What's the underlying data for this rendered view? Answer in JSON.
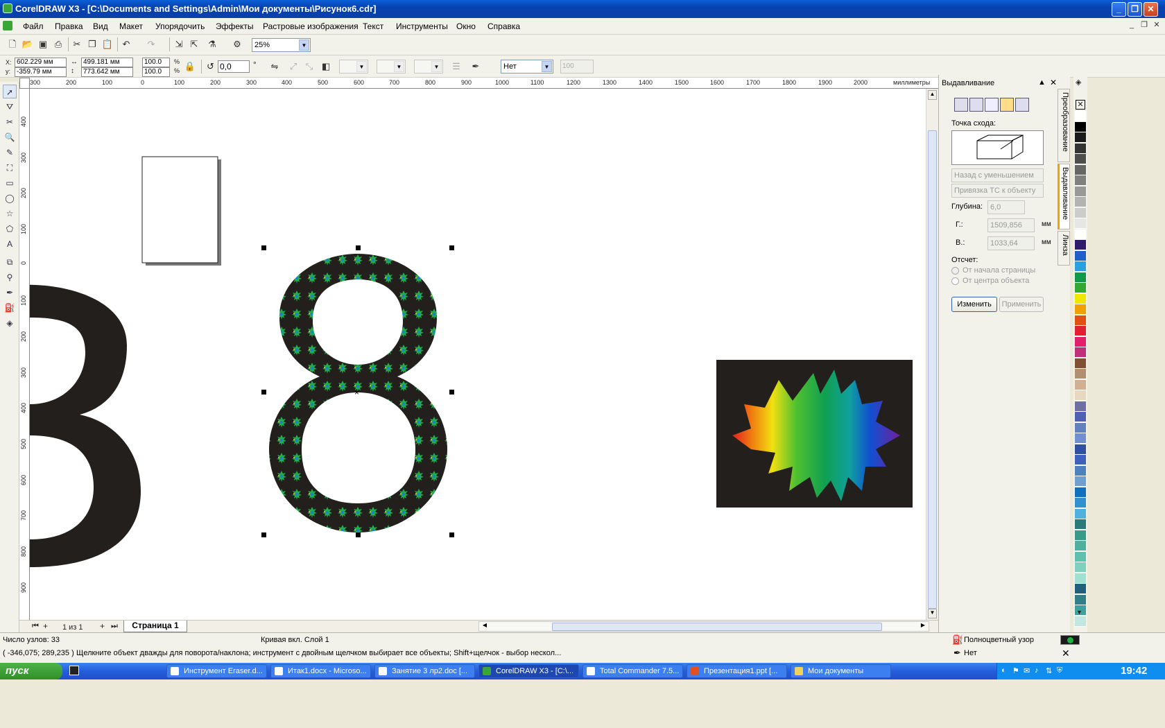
{
  "window": {
    "title": "CorelDRAW X3 - [C:\\Documents and Settings\\Admin\\Мои документы\\Рисунок6.cdr]",
    "controls": [
      "_",
      "❐",
      "✕"
    ]
  },
  "menu": [
    "Файл",
    "Правка",
    "Вид",
    "Макет",
    "Упорядочить",
    "Эффекты",
    "Растровые изображения",
    "Текст",
    "Инструменты",
    "Окно",
    "Справка"
  ],
  "standard_toolbar": {
    "zoom": "25%"
  },
  "property_bar": {
    "x": "602.229 мм",
    "y": "-359.79 мм",
    "width": "499.181 мм",
    "height": "773.642 мм",
    "scale_x": "100.0",
    "scale_y": "100.0",
    "percent": "%",
    "rotation": "0,0",
    "degree": "°",
    "outline": "Нет",
    "spin_value": "100"
  },
  "rulers": {
    "h_ticks": [
      "300",
      "200",
      "100",
      "0",
      "100",
      "200",
      "300",
      "400",
      "500",
      "600",
      "700",
      "800",
      "900",
      "1000",
      "1100",
      "1200",
      "1300",
      "1400",
      "1500",
      "1600",
      "1700",
      "1800",
      "1900",
      "2000"
    ],
    "h_unit": "миллиметры",
    "v_ticks": [
      "400",
      "300",
      "200",
      "100",
      "0",
      "100",
      "200",
      "300",
      "400",
      "500",
      "600",
      "700",
      "800",
      "900"
    ],
    "v_unit": "миллиметры"
  },
  "pages": {
    "counter": "1 из 1",
    "tab": "Страница 1"
  },
  "docker": {
    "title": "Выдавливание",
    "vanishing_label": "Точка схода:",
    "type_value": "Назад с уменьшением",
    "lock_value": "Привязка ТС к объекту",
    "depth_label": "Глубина:",
    "depth_value": "6,0",
    "h_label": "Г.:",
    "h_value": "1509,856",
    "h_unit": "мм",
    "v_label": "В.:",
    "v_value": "1033,64",
    "v_unit": "мм",
    "measure_label": "Отсчет:",
    "opt_page": "От начала страницы",
    "opt_center": "От центра объекта",
    "edit_button": "Изменить",
    "apply_button": "Применить"
  },
  "side_tabs": [
    "Преобразование",
    "Выдавливание",
    "Линза"
  ],
  "palette": [
    "#ffffff",
    "#000000",
    "#1a1a1a",
    "#333333",
    "#4d4d4d",
    "#666666",
    "#808080",
    "#999999",
    "#b3b3b3",
    "#cccccc",
    "#e6e6e6",
    "#ffffff",
    "#2e1a6e",
    "#1e5fc8",
    "#2aa0e0",
    "#0f9a4a",
    "#35a735",
    "#f0e600",
    "#f0a000",
    "#e05010",
    "#e02030",
    "#e0206a",
    "#c0307a",
    "#805030",
    "#b09070",
    "#d0b090",
    "#e8d8c0",
    "#7070a0",
    "#5060b0",
    "#6080c0",
    "#7090d0",
    "#3050a0",
    "#4060c0",
    "#5080c0",
    "#70a0d0",
    "#1070c0",
    "#3090d0",
    "#50b0e0",
    "#2a7a7a",
    "#3a9a8a",
    "#50b0a0",
    "#60c0b0",
    "#80d0c0",
    "#a0e0d0",
    "#20607a",
    "#30808a",
    "#40a0a0",
    "#c0e8e0"
  ],
  "status": {
    "nodes": "Число узлов: 33",
    "object_info": "Кривая вкл. Слой 1",
    "coords": "( -346,075; 289,235 )",
    "hint": "Щелкните объект дважды для поворота/наклона; инструмент с двойным щелчком выбирает все объекты; Shift+щелчок - выбор нескол...",
    "fill": "Полноцветный узор",
    "outline": "Нет"
  },
  "taskbar": {
    "start": "пуск",
    "tasks": [
      "Инструмент Eraser.d...",
      "Итак1.docx - Microso...",
      "Занятие 3 лр2.doc [...",
      "CorelDRAW X3 - [C:\\...",
      "Total Commander 7.5...",
      "Презентация1.ppt [...",
      "Мои документы"
    ],
    "clock": "19:42"
  }
}
